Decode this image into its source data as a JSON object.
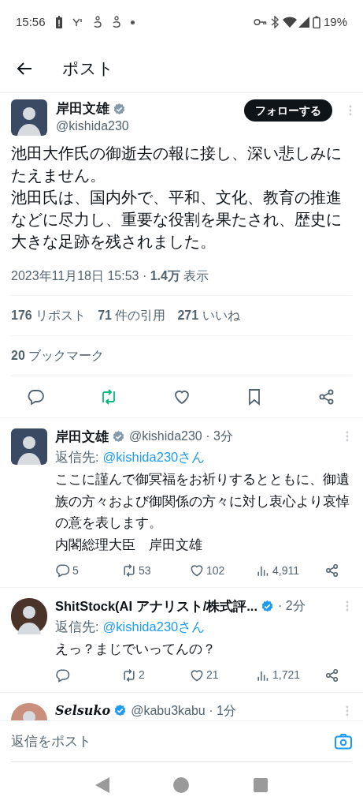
{
  "status_bar": {
    "time": "15:56",
    "battery": "19%"
  },
  "header": {
    "title": "ポスト"
  },
  "tweet": {
    "name": "岸田文雄",
    "badge": {
      "color": "#829aab"
    },
    "handle": "@kishida230",
    "follow_button": "フォローする",
    "paragraphs": [
      "池田大作氏の御逝去の報に接し、深い悲しみにたえません。",
      "池田氏は、国内外で、平和、文化、教育の推進などに尽力し、重要な役割を果たされ、歴史に大きな足跡を残されました。"
    ],
    "meta": "2023年11月18日 15:53 · **1.4万** 表示",
    "stats": [
      "**176** リポスト",
      "**71** 件の引用",
      "**271** いいね"
    ],
    "bookmarks": "**20** ブックマーク",
    "reposted": true
  },
  "replies": [
    {
      "name": "岸田文雄",
      "name_script": false,
      "badge": {
        "color": "#829aab"
      },
      "meta": "@kishida230 · 3分",
      "reply_to_label": "返信先:",
      "reply_to": "@kishida230さん",
      "lines": [
        "ここに謹んで御冥福をお祈りするとともに、御遺族の方々および御関係の方々に対し衷心より哀悼の意を表します。",
        "内閣総理大臣　岸田文雄"
      ],
      "counts": {
        "replies": "5",
        "reposts": "53",
        "likes": "102",
        "views": "4,911"
      }
    },
    {
      "name": "ShitStock(AI アナリスト/株式評...",
      "name_script": false,
      "badge": {
        "color": "#1d9bf0"
      },
      "meta": "· 2分",
      "reply_to_label": "返信先:",
      "reply_to": "@kishida230さん",
      "lines": [
        "えっ？まじでいってんの？"
      ],
      "counts": {
        "reposts": "2",
        "likes": "21",
        "views": "1,721"
      }
    },
    {
      "name": "Selsuko",
      "name_script": true,
      "badge": {
        "color": "#1d9bf0"
      },
      "meta": "@kabu3kabu · 1分"
    }
  ],
  "composer": {
    "placeholder": "返信をポスト"
  }
}
